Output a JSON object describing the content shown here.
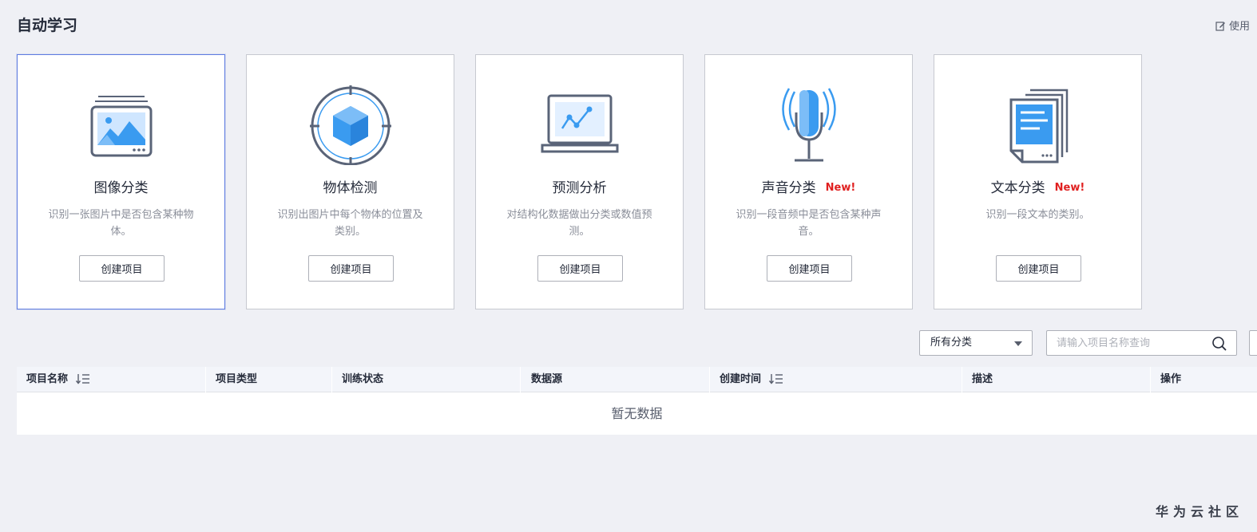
{
  "page": {
    "title": "自动学习",
    "guide_link": "使用"
  },
  "cards": [
    {
      "title": "图像分类",
      "badge": "",
      "desc": "识别一张图片中是否包含某种物体。",
      "button": "创建项目",
      "icon": "image-classification-icon"
    },
    {
      "title": "物体检测",
      "badge": "",
      "desc": "识别出图片中每个物体的位置及类别。",
      "button": "创建项目",
      "icon": "object-detection-icon"
    },
    {
      "title": "预测分析",
      "badge": "",
      "desc": "对结构化数据做出分类或数值预测。",
      "button": "创建项目",
      "icon": "predictive-analysis-icon"
    },
    {
      "title": "声音分类",
      "badge": "New!",
      "desc": "识别一段音频中是否包含某种声音。",
      "button": "创建项目",
      "icon": "microphone-icon"
    },
    {
      "title": "文本分类",
      "badge": "New!",
      "desc": "识别一段文本的类别。",
      "button": "创建项目",
      "icon": "document-icon"
    }
  ],
  "filters": {
    "category": "所有分类",
    "search_placeholder": "请输入项目名称查询"
  },
  "table": {
    "columns": [
      {
        "label": "项目名称",
        "sortable": true
      },
      {
        "label": "项目类型",
        "sortable": false
      },
      {
        "label": "训练状态",
        "sortable": false
      },
      {
        "label": "数据源",
        "sortable": false
      },
      {
        "label": "创建时间",
        "sortable": true
      },
      {
        "label": "描述",
        "sortable": false
      },
      {
        "label": "操作",
        "sortable": false
      }
    ],
    "empty_text": "暂无数据"
  },
  "watermark": "华为云社区",
  "colors": {
    "accent": "#5e7ce0",
    "badge": "#e02020",
    "icon_blue": "#3a9bf0",
    "icon_outline": "#5a6478"
  }
}
